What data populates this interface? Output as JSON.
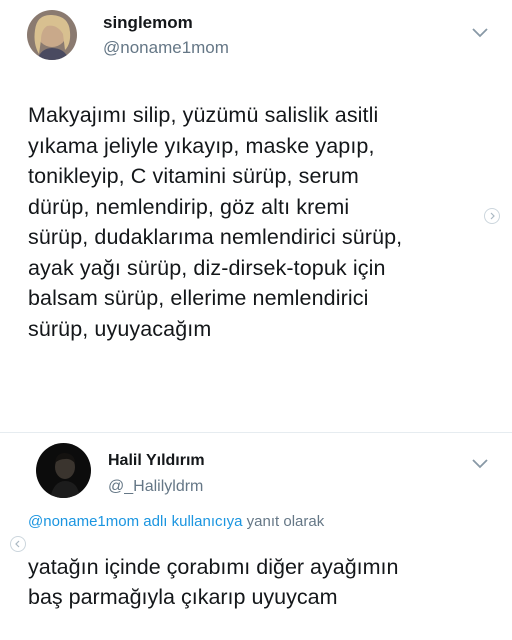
{
  "tweet": {
    "display_name": "singlemom",
    "handle": "@noname1mom",
    "text": "Makyajımı silip, yüzümü salislik asitli\nyıkama jeliyle yıkayıp, maske yapıp,\ntonikleyip, C vitamini sürüp, serum\ndürüp, nemlendirip, göz altı kremi\nsürüp, dudaklarıma nemlendirici sürüp,\nayak yağı sürüp, diz-dirsek-topuk için\nbalsam sürüp, ellerime nemlendirici\nsürüp, uyuyacağım",
    "menu_icon": "chevron-down-icon"
  },
  "reply": {
    "display_name": "Halil Yıldırım",
    "handle": "@_Halilyldrm",
    "reply_to_mention": "@noname1mom adlı kullanıcıya",
    "reply_to_suffix": "yanıt olarak",
    "text": "yatağın içinde çorabımı diğer ayağımın\nbaş parmağıyla çıkarıp uyuycam",
    "menu_icon": "chevron-down-icon"
  },
  "colors": {
    "text": "#14171a",
    "secondary": "#657786",
    "link": "#1b95e0",
    "divider": "#e6ecf0"
  }
}
